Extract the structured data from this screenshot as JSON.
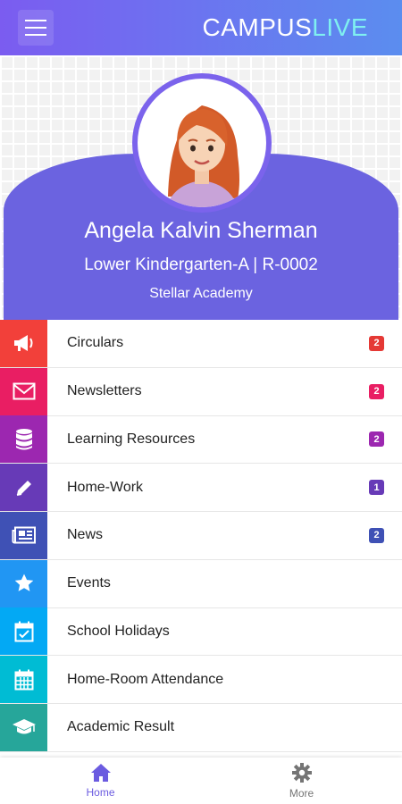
{
  "header": {
    "brand_part1": "CAMPUS",
    "brand_part2": "LIVE",
    "menu_icon": "hamburger-menu-icon"
  },
  "profile": {
    "name": "Angela Kalvin Sherman",
    "class_info": "Lower Kindergarten-A | R-0002",
    "school": "Stellar Academy",
    "avatar_icon": "student-avatar"
  },
  "menu": {
    "items": [
      {
        "label": "Circulars",
        "icon": "megaphone-icon",
        "color": "#f2403a",
        "badge": "2",
        "badge_color": "#e53935"
      },
      {
        "label": "Newsletters",
        "icon": "envelope-icon",
        "color": "#e91e63",
        "badge": "2",
        "badge_color": "#e91e63"
      },
      {
        "label": "Learning Resources",
        "icon": "database-icon",
        "color": "#9c27b0",
        "badge": "2",
        "badge_color": "#9c27b0"
      },
      {
        "label": "Home-Work",
        "icon": "pencil-icon",
        "color": "#673ab7",
        "badge": "1",
        "badge_color": "#673ab7"
      },
      {
        "label": "News",
        "icon": "newspaper-icon",
        "color": "#3f51b5",
        "badge": "2",
        "badge_color": "#3f51b5"
      },
      {
        "label": "Events",
        "icon": "star-icon",
        "color": "#2196f3",
        "badge": "",
        "badge_color": ""
      },
      {
        "label": "School Holidays",
        "icon": "calendar-check-icon",
        "color": "#03a9f4",
        "badge": "",
        "badge_color": ""
      },
      {
        "label": "Home-Room Attendance",
        "icon": "calendar-grid-icon",
        "color": "#00bcd4",
        "badge": "",
        "badge_color": ""
      },
      {
        "label": "Academic Result",
        "icon": "graduation-cap-icon",
        "color": "#26a69a",
        "badge": "",
        "badge_color": ""
      }
    ]
  },
  "bottom_nav": {
    "home_label": "Home",
    "more_label": "More",
    "active_color": "#6b5be0",
    "inactive_color": "#757575"
  }
}
